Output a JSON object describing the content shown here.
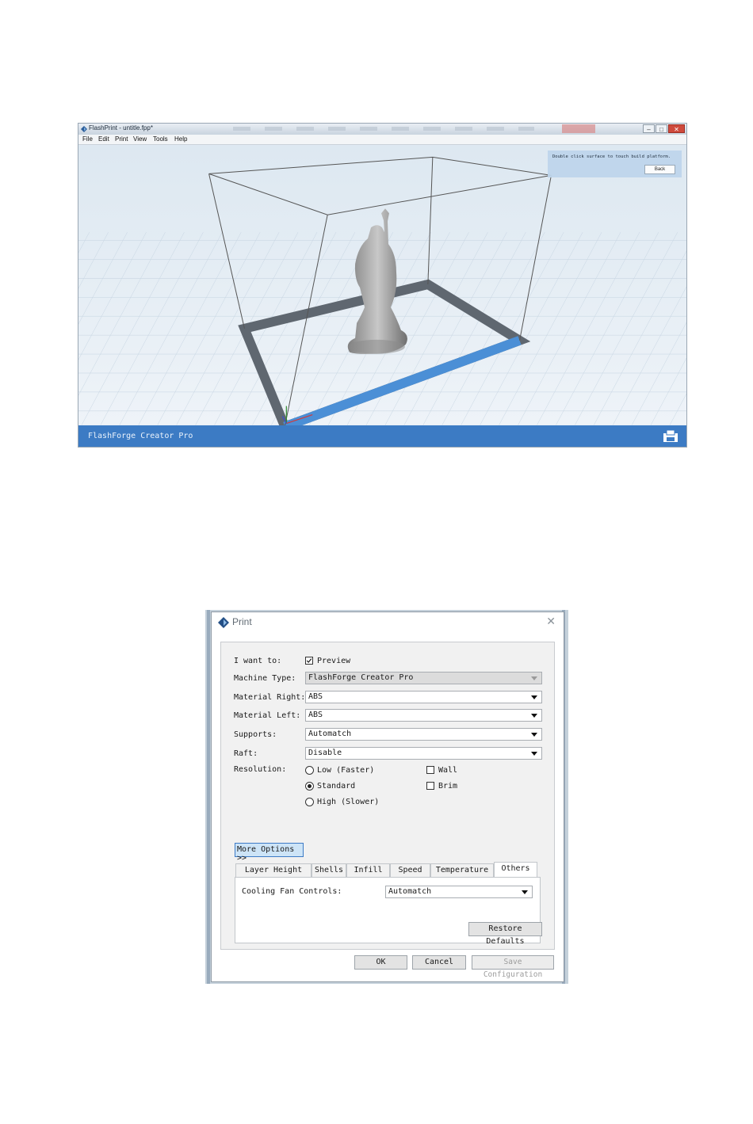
{
  "main_window": {
    "title": "FlashPrint - untitle.fpp*",
    "window_controls": {
      "minimize": "–",
      "maximize": "□",
      "close": "✕"
    },
    "menu": [
      "File",
      "Edit",
      "Print",
      "View",
      "Tools",
      "Help"
    ],
    "hint": {
      "text": "Double click surface to touch build platform.",
      "back_label": "Back"
    },
    "status_machine": "FlashForge Creator Pro",
    "colors": {
      "status_bar": "#3c7bc4",
      "platform_edge_front": "#4b8fd6"
    }
  },
  "print_dialog": {
    "title": "Print",
    "close": "✕",
    "i_want_to_label": "I want to:",
    "preview_label": "Preview",
    "preview_checked": true,
    "machine_type_label": "Machine Type:",
    "machine_type_value": "FlashForge Creator Pro",
    "material_right_label": "Material Right:",
    "material_right_value": "ABS",
    "material_left_label": "Material Left:",
    "material_left_value": "ABS",
    "supports_label": "Supports:",
    "supports_value": "Automatch",
    "raft_label": "Raft:",
    "raft_value": "Disable",
    "resolution_label": "Resolution:",
    "resolution_options": [
      "Low (Faster)",
      "Standard",
      "High (Slower)"
    ],
    "resolution_selected": "Standard",
    "wall_label": "Wall",
    "brim_label": "Brim",
    "more_options_label": "More Options >>",
    "tabs": [
      "Layer Height",
      "Shells",
      "Infill",
      "Speed",
      "Temperature",
      "Others"
    ],
    "active_tab": "Others",
    "cooling_label": "Cooling Fan Controls:",
    "cooling_value": "Automatch",
    "restore_defaults_label": "Restore Defaults",
    "ok_label": "OK",
    "cancel_label": "Cancel",
    "save_config_label": "Save Configuration"
  }
}
